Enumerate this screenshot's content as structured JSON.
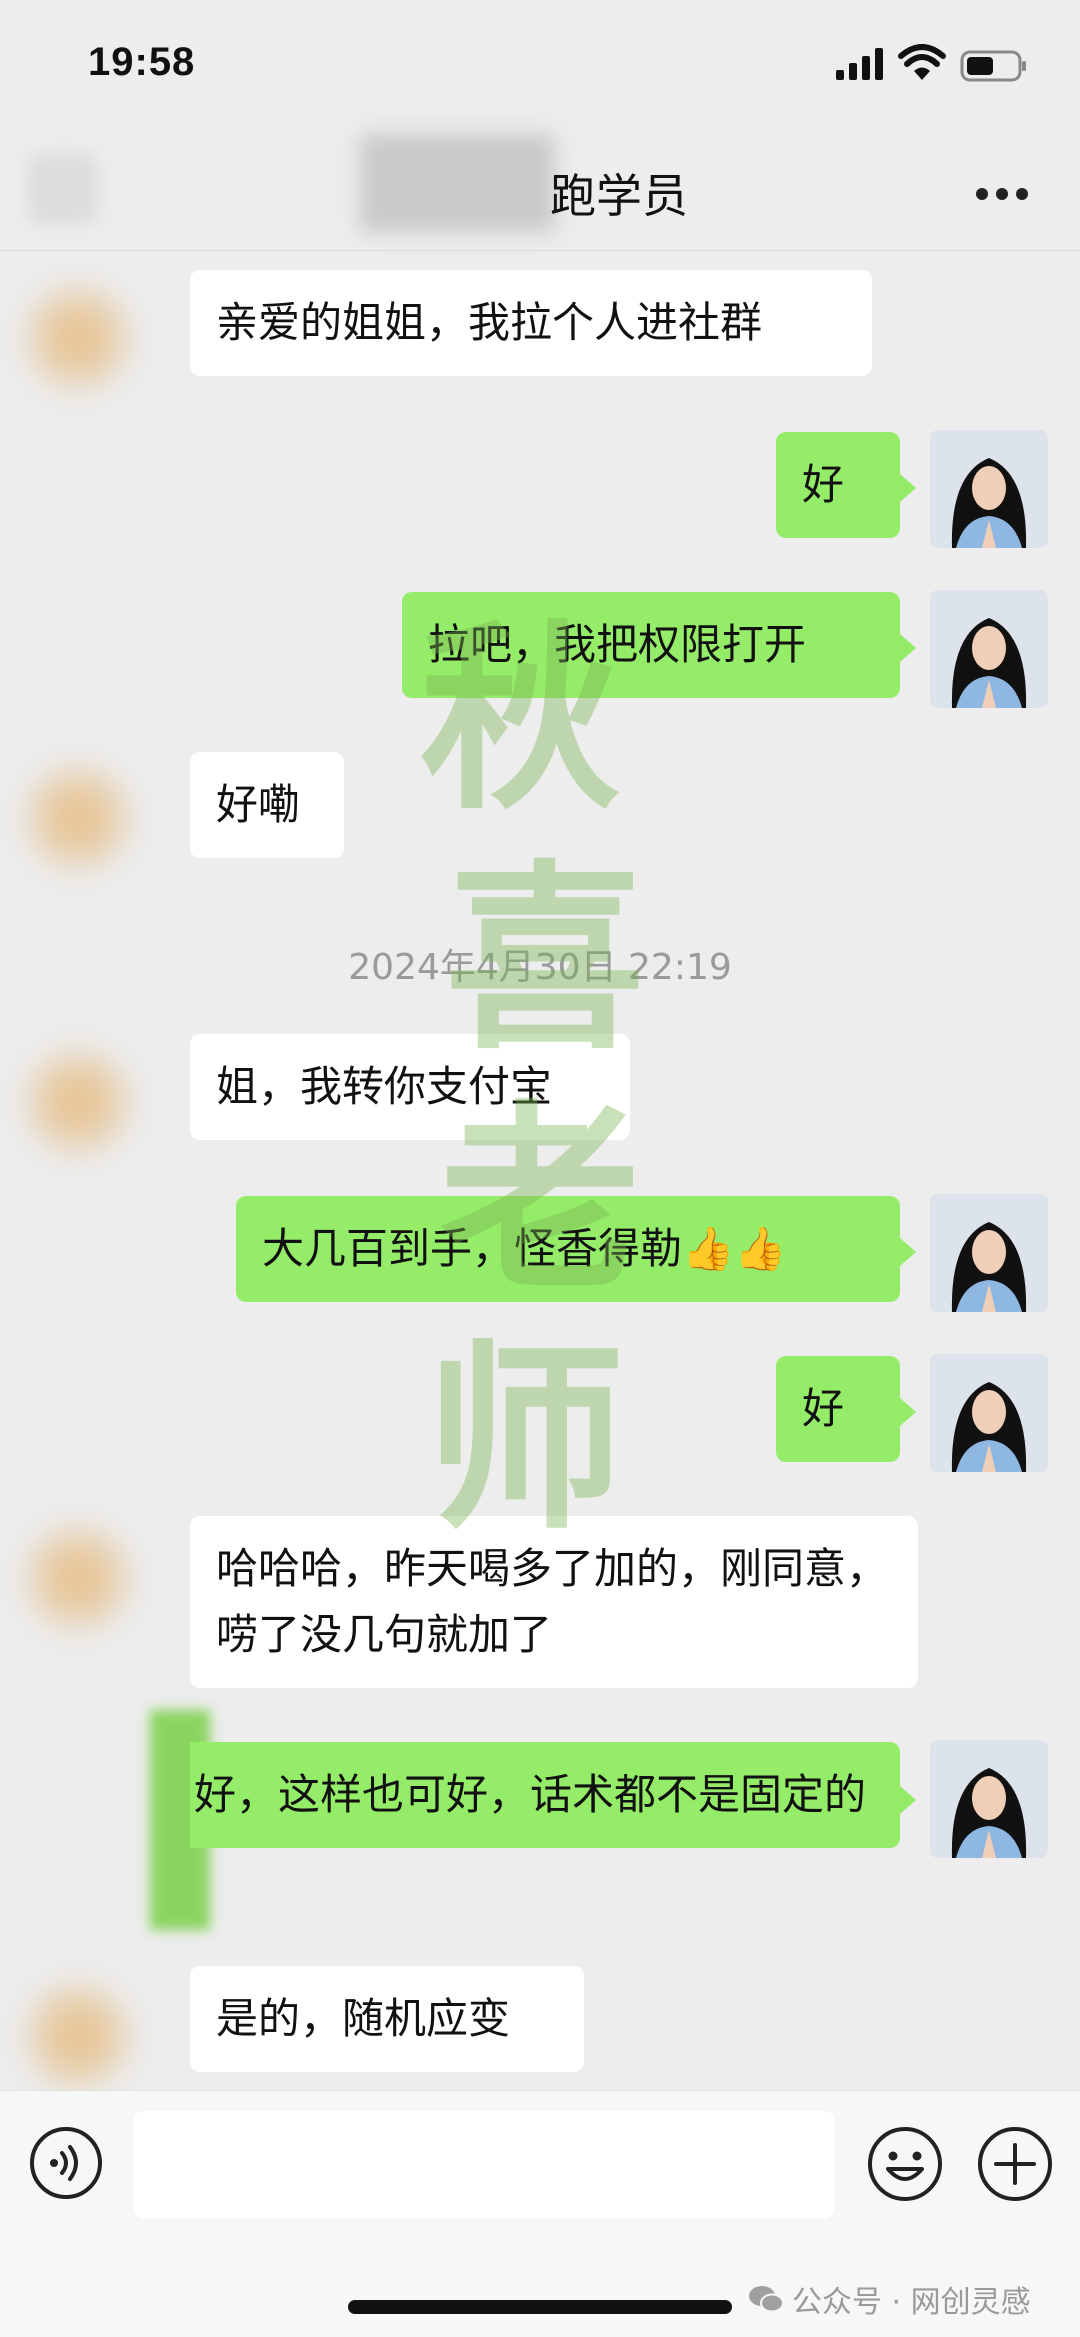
{
  "status_bar": {
    "time": "19:58"
  },
  "header": {
    "title": "跑学员"
  },
  "timestamp": "2024年4月30日 22:19",
  "messages": [
    {
      "side": "in",
      "text": "亲爱的姐姐，我拉个人进社群"
    },
    {
      "side": "out",
      "text": "好"
    },
    {
      "side": "out",
      "text": "拉吧，我把权限打开"
    },
    {
      "side": "in",
      "text": "好嘞"
    },
    {
      "side": "in",
      "text": "姐，我转你支付宝"
    },
    {
      "side": "out",
      "text": "大几百到手，怪香得勒👍👍"
    },
    {
      "side": "out",
      "text": "好"
    },
    {
      "side": "in",
      "text": "哈哈哈，昨天喝多了加的，刚同意，唠了没几句就加了"
    },
    {
      "side": "out",
      "text": "好，这样也可好，话术都不是固定的"
    },
    {
      "side": "in",
      "text": "是的，随机应变"
    }
  ],
  "watermark": {
    "chars": [
      "秋",
      "喜",
      "老",
      "师"
    ]
  },
  "input_bar": {
    "value": ""
  },
  "credit": {
    "text": "公众号 · 网创灵感"
  },
  "colors": {
    "outgoing_bubble": "#95ec69",
    "incoming_bubble": "#ffffff",
    "background": "#ededed"
  },
  "icons": [
    "signal-icon",
    "wifi-icon",
    "battery-icon",
    "more-icon",
    "voice-icon",
    "emoji-icon",
    "plus-icon",
    "wechat-icon"
  ]
}
